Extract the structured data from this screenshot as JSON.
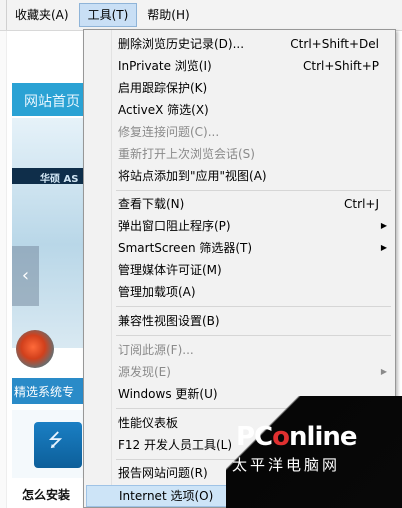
{
  "menubar": {
    "items": [
      {
        "label": "收藏夹(A)"
      },
      {
        "label": "工具(T)"
      },
      {
        "label": "帮助(H)"
      }
    ]
  },
  "page": {
    "banner_text": "网站首页",
    "hero_band_text": "华硕 AS",
    "hero_arrow": "‹",
    "section_text": "精选系统专",
    "caption": "怎么安装"
  },
  "tools_menu": {
    "items": [
      {
        "label": "删除浏览历史记录(D)...",
        "shortcut": "Ctrl+Shift+Del"
      },
      {
        "label": "InPrivate 浏览(I)",
        "shortcut": "Ctrl+Shift+P"
      },
      {
        "label": "启用跟踪保护(K)"
      },
      {
        "label": "ActiveX 筛选(X)"
      },
      {
        "label": "修复连接问题(C)...",
        "disabled": true
      },
      {
        "label": "重新打开上次浏览会话(S)",
        "disabled": true
      },
      {
        "label": "将站点添加到\"应用\"视图(A)"
      },
      {
        "label": "查看下载(N)",
        "shortcut": "Ctrl+J"
      },
      {
        "label": "弹出窗口阻止程序(P)",
        "submenu": true
      },
      {
        "label": "SmartScreen 筛选器(T)",
        "submenu": true
      },
      {
        "label": "管理媒体许可证(M)"
      },
      {
        "label": "管理加载项(A)"
      },
      {
        "label": "兼容性视图设置(B)"
      },
      {
        "label": "订阅此源(F)...",
        "disabled": true
      },
      {
        "label": "源发现(E)",
        "disabled": true,
        "submenu": true
      },
      {
        "label": "Windows 更新(U)"
      },
      {
        "label": "性能仪表板"
      },
      {
        "label": "F12 开发人员工具(L)"
      },
      {
        "label": "报告网站问题(R)"
      },
      {
        "label": "Internet 选项(O)",
        "highlighted": true
      }
    ],
    "submenu_arrow": "▶"
  },
  "watermark": {
    "logo_prefix": "PC",
    "logo_o": "o",
    "logo_suffix": "nline",
    "sub": "太平洋电脑网"
  }
}
